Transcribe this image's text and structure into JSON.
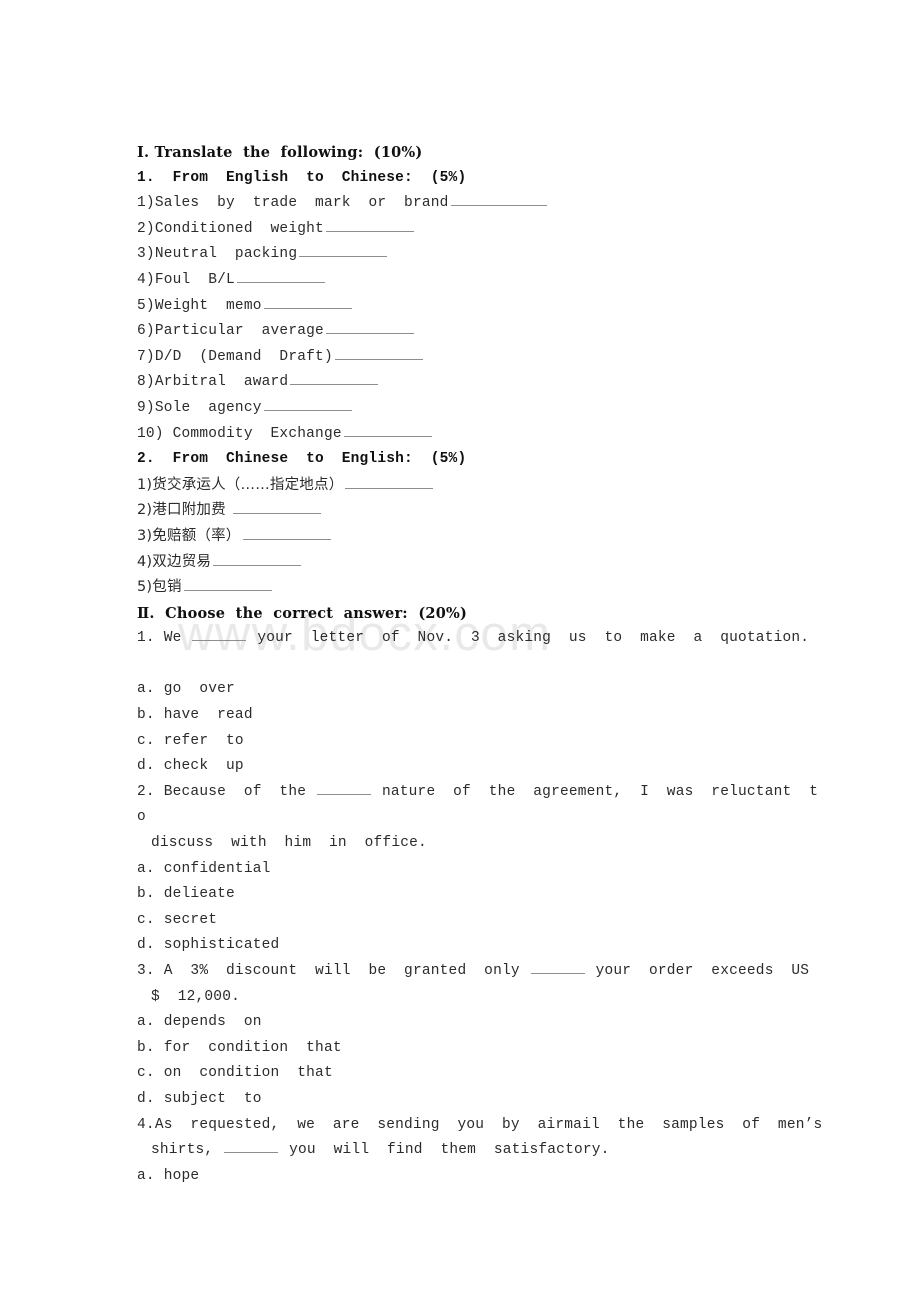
{
  "watermark": {
    "text": "www.bdocx.com",
    "color": "#e9e9e9"
  },
  "document": {
    "section_1": {
      "heading": "Ⅰ. Translate  the  following:  (10%)",
      "part_1": {
        "heading": "1.  From  English  to  Chinese:  (5%)",
        "items": [
          {
            "num": "1)",
            "text": "Sales  by  trade  mark  or  brand"
          },
          {
            "num": "2)",
            "text": "Conditioned  weight"
          },
          {
            "num": "3)",
            "text": "Neutral  packing"
          },
          {
            "num": "4)",
            "text": "Foul  B/L"
          },
          {
            "num": "5)",
            "text": "Weight  memo"
          },
          {
            "num": "6)",
            "text": "Particular  average"
          },
          {
            "num": "7)",
            "text": "D/D  (Demand  Draft)"
          },
          {
            "num": "8)",
            "text": "Arbitral  award"
          },
          {
            "num": "9)",
            "text": "Sole  agency"
          },
          {
            "num": "10)",
            "text": " Commodity  Exchange"
          }
        ]
      },
      "part_2": {
        "heading": "2.  From  Chinese  to  English:  (5%)",
        "items": [
          {
            "num": "1)",
            "text": "货交承运人（……指定地点）"
          },
          {
            "num": "2)",
            "text": "港口附加费 "
          },
          {
            "num": "3)",
            "text": "免赔额（率）"
          },
          {
            "num": "4)",
            "text": "双边贸易"
          },
          {
            "num": "5)",
            "text": "包销"
          }
        ]
      }
    },
    "section_2": {
      "heading": "Ⅱ.  Choose  the  correct  answer:  (20%)",
      "questions": [
        {
          "num": "1.",
          "stem_before": " We ",
          "stem_after": " your  letter  of  Nov.  3  asking  us  to  make  a  quotation.",
          "options": [
            {
              "letter": "a.",
              "text": " go  over"
            },
            {
              "letter": "b.",
              "text": " have  read"
            },
            {
              "letter": "c.",
              "text": " refer  to"
            },
            {
              "letter": "d.",
              "text": " check  up"
            }
          ]
        },
        {
          "num": "2.",
          "stem_before": " Because  of  the ",
          "stem_after": " nature  of  the  agreement,  I  was  reluctant  t",
          "stem_wrap1": "o",
          "stem_wrap2": "discuss  with  him  in  office.",
          "options": [
            {
              "letter": "a.",
              "text": " confidential"
            },
            {
              "letter": "b.",
              "text": " delieate"
            },
            {
              "letter": "c.",
              "text": " secret"
            },
            {
              "letter": "d.",
              "text": " sophisticated"
            }
          ]
        },
        {
          "num": "3.",
          "stem_before": " A  3%  discount  will  be  granted  only ",
          "stem_after": " your  order  exceeds  US",
          "stem_wrap2": "$  12,000.",
          "options": [
            {
              "letter": "a.",
              "text": " depends  on"
            },
            {
              "letter": "b.",
              "text": " for  condition  that"
            },
            {
              "letter": "c.",
              "text": " on  condition  that"
            },
            {
              "letter": "d.",
              "text": " subject  to"
            }
          ]
        },
        {
          "num": "4.",
          "stem_before": "As  requested,  we  are  sending  you  by  airmail  the  samples  of  men’s",
          "stem_wrap_before": "shirts, ",
          "stem_wrap_after": " you  will  find  them  satisfactory.",
          "options": [
            {
              "letter": "a.",
              "text": " hope"
            }
          ]
        }
      ]
    }
  }
}
